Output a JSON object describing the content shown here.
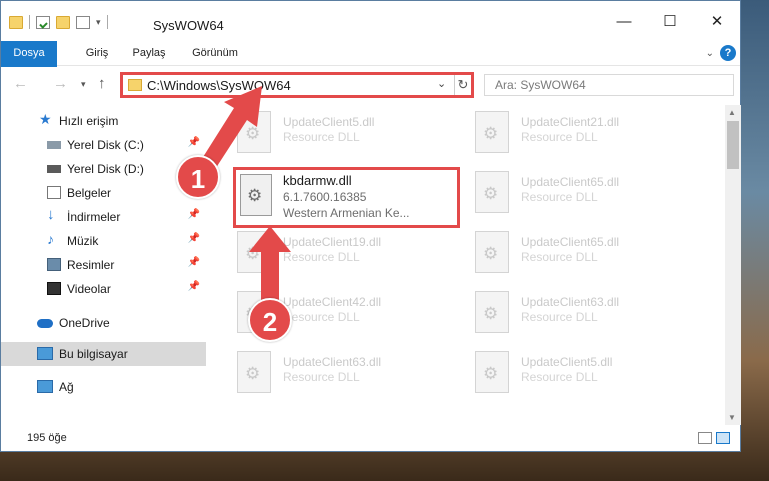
{
  "window": {
    "title": "SysWOW64"
  },
  "ribbon": {
    "tabs": [
      "Dosya",
      "Giriş",
      "Paylaş",
      "Görünüm"
    ],
    "help": "?"
  },
  "address": {
    "path": "C:\\Windows\\SysWOW64"
  },
  "search": {
    "placeholder": "Ara: SysWOW64"
  },
  "sidebar": {
    "items": [
      {
        "label": "Hızlı erişim"
      },
      {
        "label": "Yerel Disk (C:)"
      },
      {
        "label": "Yerel Disk (D:)"
      },
      {
        "label": "Belgeler"
      },
      {
        "label": "İndirmeler"
      },
      {
        "label": "Müzik"
      },
      {
        "label": "Resimler"
      },
      {
        "label": "Videolar"
      },
      {
        "label": "OneDrive"
      },
      {
        "label": "Bu bilgisayar"
      },
      {
        "label": "Ağ"
      }
    ]
  },
  "files": [
    {
      "name": "UpdateClient5.dll",
      "desc": "Resource DLL"
    },
    {
      "name": "UpdateClient21.dll",
      "desc": "Resource DLL"
    },
    {
      "name": "UpdateClient65.dll",
      "desc": "Resource DLL"
    },
    {
      "name": "UpdateClient19.dll",
      "desc": "Resource DLL"
    },
    {
      "name": "UpdateClient65.dll",
      "desc": "Resource DLL"
    },
    {
      "name": "UpdateClient42.dll",
      "desc": "Resource DLL"
    },
    {
      "name": "UpdateClient63.dll",
      "desc": "Resource DLL"
    },
    {
      "name": "UpdateClient63.dll",
      "desc": "Resource DLL"
    },
    {
      "name": "UpdateClient5.dll",
      "desc": "Resource DLL"
    }
  ],
  "highlighted_file": {
    "name": "kbdarmw.dll",
    "version": "6.1.7600.16385",
    "desc": "Western Armenian Ke..."
  },
  "status": {
    "count": "195 öğe"
  },
  "annotations": {
    "step1": "1",
    "step2": "2"
  },
  "colors": {
    "accent": "#1979ca",
    "annotation": "#e34a4a"
  }
}
